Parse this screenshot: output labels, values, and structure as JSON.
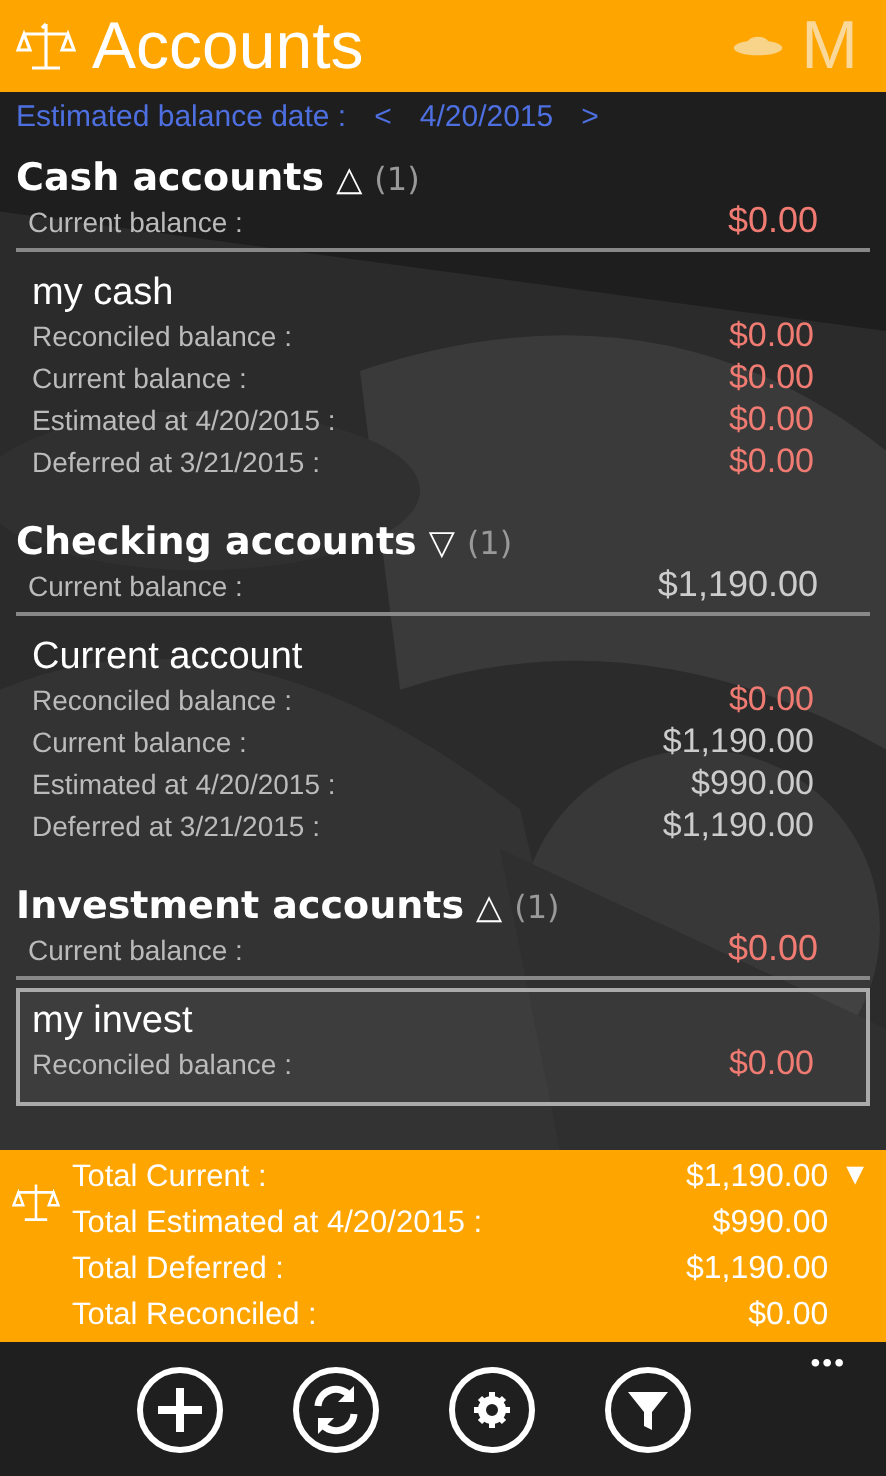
{
  "header": {
    "title": "Accounts",
    "profile_letter": "M"
  },
  "date_bar": {
    "label": "Estimated balance date :",
    "prev": "<",
    "date": "4/20/2015",
    "next": ">"
  },
  "groups": [
    {
      "title": "Cash accounts",
      "toggle": "△",
      "count": "(1)",
      "summary": {
        "label": "Current balance :",
        "value": "$0.00",
        "alert": true
      },
      "accounts": [
        {
          "name": "my cash",
          "selected": false,
          "rows": [
            {
              "label": "Reconciled balance :",
              "value": "$0.00",
              "alert": true
            },
            {
              "label": "Current balance :",
              "value": "$0.00",
              "alert": true
            },
            {
              "label": "Estimated at 4/20/2015 :",
              "value": "$0.00",
              "alert": true
            },
            {
              "label": "Deferred at 3/21/2015 :",
              "value": "$0.00",
              "alert": true
            }
          ]
        }
      ]
    },
    {
      "title": "Checking accounts",
      "toggle": "▽",
      "count": "(1)",
      "summary": {
        "label": "Current balance :",
        "value": "$1,190.00",
        "alert": false
      },
      "accounts": [
        {
          "name": "Current account",
          "selected": false,
          "rows": [
            {
              "label": "Reconciled balance :",
              "value": "$0.00",
              "alert": true
            },
            {
              "label": "Current balance :",
              "value": "$1,190.00",
              "alert": false
            },
            {
              "label": "Estimated at 4/20/2015 :",
              "value": "$990.00",
              "alert": false
            },
            {
              "label": "Deferred at 3/21/2015 :",
              "value": "$1,190.00",
              "alert": false
            }
          ]
        }
      ]
    },
    {
      "title": "Investment accounts",
      "toggle": "△",
      "count": "(1)",
      "summary": {
        "label": "Current balance :",
        "value": "$0.00",
        "alert": true
      },
      "accounts": [
        {
          "name": "my invest",
          "selected": true,
          "rows": [
            {
              "label": "Reconciled balance :",
              "value": "$0.00",
              "alert": true
            }
          ]
        }
      ]
    }
  ],
  "totals": {
    "expand": "▼",
    "rows": [
      {
        "label": "Total Current :",
        "value": "$1,190.00"
      },
      {
        "label": "Total Estimated at 4/20/2015 :",
        "value": "$990.00"
      },
      {
        "label": "Total Deferred :",
        "value": "$1,190.00"
      },
      {
        "label": "Total Reconciled :",
        "value": "$0.00"
      }
    ]
  },
  "app_bar": {
    "buttons": [
      {
        "kind": "add"
      },
      {
        "kind": "sync"
      },
      {
        "kind": "settings"
      },
      {
        "kind": "filter"
      }
    ],
    "more": "•••"
  }
}
